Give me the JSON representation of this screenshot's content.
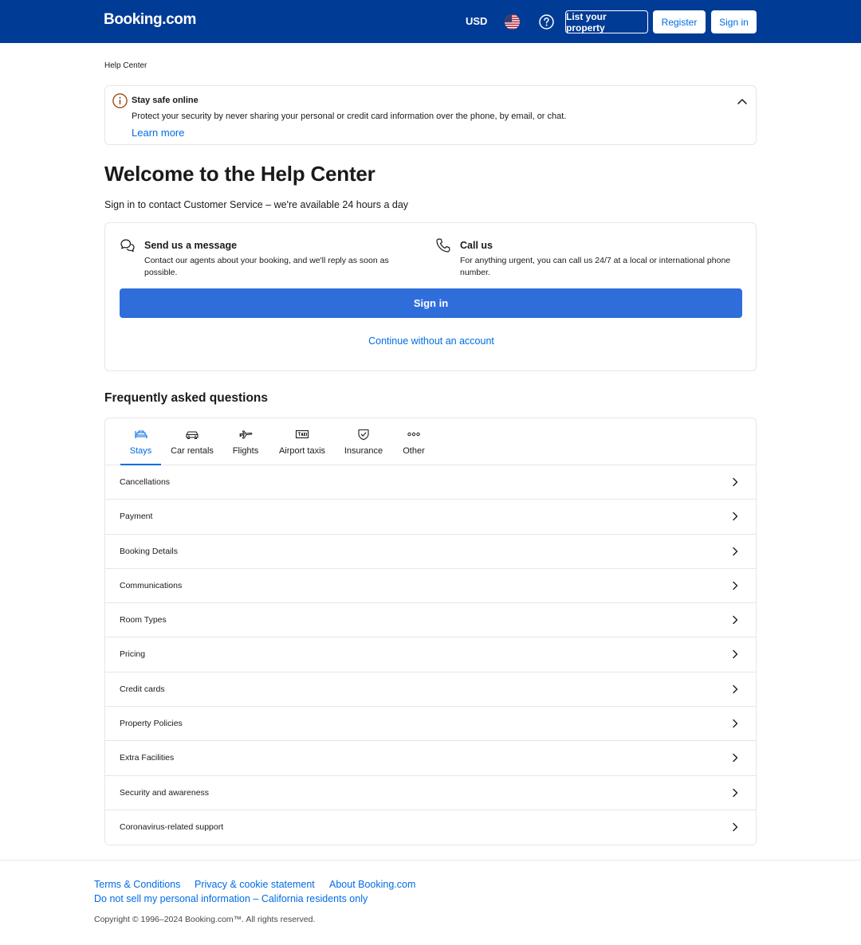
{
  "header": {
    "logo": "Booking.com",
    "currency": "USD",
    "list_property": "List your property",
    "register": "Register",
    "sign_in": "Sign in"
  },
  "breadcrumb": "Help Center",
  "alert": {
    "title": "Stay safe online",
    "text": "Protect your security by never sharing your personal or credit card information over the phone, by email, or chat.",
    "link": "Learn more"
  },
  "page": {
    "title": "Welcome to the Help Center",
    "subtitle": "Sign in to contact Customer Service – we're available 24 hours a day"
  },
  "contact": {
    "message_title": "Send us a message",
    "message_text": "Contact our agents about your booking, and we'll reply as soon as possible.",
    "call_title": "Call us",
    "call_text": "For anything urgent, you can call us 24/7 at a local or international phone number.",
    "sign_in": "Sign in",
    "continue": "Continue without an account"
  },
  "faq": {
    "title": "Frequently asked questions",
    "tabs": [
      {
        "label": "Stays",
        "icon": "bed-icon",
        "active": true
      },
      {
        "label": "Car rentals",
        "icon": "car-icon",
        "active": false
      },
      {
        "label": "Flights",
        "icon": "plane-icon",
        "active": false
      },
      {
        "label": "Airport taxis",
        "icon": "taxi-icon",
        "active": false
      },
      {
        "label": "Insurance",
        "icon": "shield-icon",
        "active": false
      },
      {
        "label": "Other",
        "icon": "more-icon",
        "active": false
      }
    ],
    "rows": [
      "Cancellations",
      "Payment",
      "Booking Details",
      "Communications",
      "Room Types",
      "Pricing",
      "Credit cards",
      "Property Policies",
      "Extra Facilities",
      "Security and awareness",
      "Coronavirus-related support"
    ]
  },
  "footer": {
    "terms": "Terms & Conditions",
    "privacy": "Privacy & cookie statement",
    "about": "About Booking.com",
    "do_not_sell": "Do not sell my personal information – California residents only",
    "copyright": "Copyright © 1996–2024 Booking.com™. All rights reserved."
  },
  "colors": {
    "brand": "#003b95",
    "accent": "#006ce4",
    "primary_button": "#2f6ddb"
  }
}
